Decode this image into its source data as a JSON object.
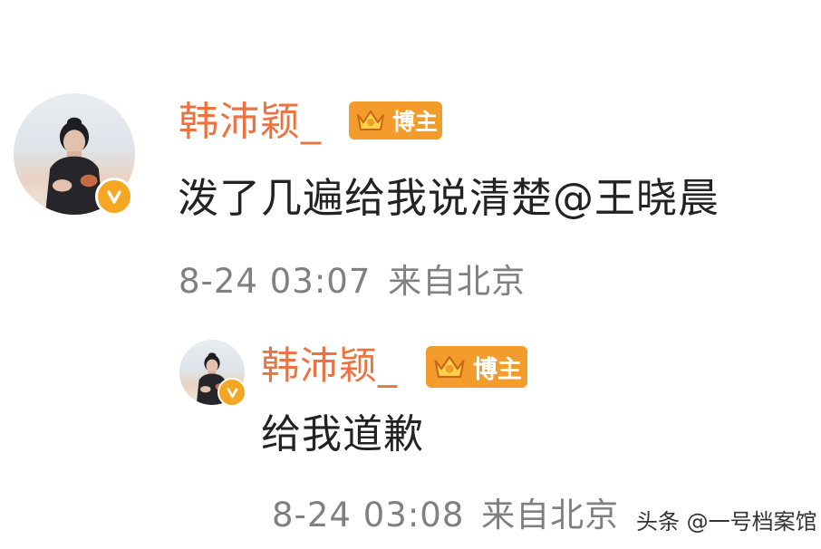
{
  "comments": [
    {
      "username": "韩沛颖_",
      "badge_label": "博主",
      "text": "泼了几遍给我说清楚@王晓晨",
      "timestamp": "8-24 03:07",
      "location": "来自北京"
    },
    {
      "username": "韩沛颖_",
      "badge_label": "博主",
      "text": "给我道歉",
      "timestamp": "8-24 03:08",
      "location": "来自北京"
    }
  ],
  "watermark": "头条 @一号档案馆",
  "colors": {
    "username": "#eb7340",
    "badge": "#f39c2b",
    "verified": "#f5a623",
    "body_text": "#222222",
    "meta_text": "#808080"
  },
  "icons": {
    "verified": "verified-v-icon",
    "badge": "crown-icon"
  }
}
